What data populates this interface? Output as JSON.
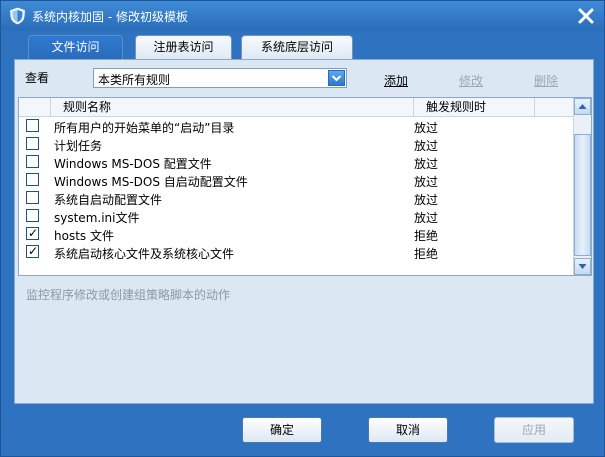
{
  "window": {
    "title": "系统内核加固  -  修改初级模板"
  },
  "tabs": [
    {
      "label": "文件访问",
      "active": true
    },
    {
      "label": "注册表访问",
      "active": false
    },
    {
      "label": "系统底层访问",
      "active": false
    }
  ],
  "filter": {
    "label": "查看",
    "selected": "本类所有规则"
  },
  "actions": {
    "add": "添加",
    "edit": "修改",
    "delete": "删除"
  },
  "list": {
    "columns": [
      "规则名称",
      "触发规则时"
    ],
    "rows": [
      {
        "name": "所有用户的开始菜单的“启动”目录",
        "trigger": "放过",
        "checked": false
      },
      {
        "name": "计划任务",
        "trigger": "放过",
        "checked": false
      },
      {
        "name": "Windows MS-DOS 配置文件",
        "trigger": "放过",
        "checked": false
      },
      {
        "name": "Windows MS-DOS 自启动配置文件",
        "trigger": "放过",
        "checked": false
      },
      {
        "name": "系统自启动配置文件",
        "trigger": "放过",
        "checked": false
      },
      {
        "name": "system.ini文件",
        "trigger": "放过",
        "checked": false
      },
      {
        "name": "hosts 文件",
        "trigger": "拒绝",
        "checked": true
      },
      {
        "name": "系统启动核心文件及系统核心文件",
        "trigger": "拒绝",
        "checked": true
      }
    ]
  },
  "description": "监控程序修改或创建组策略脚本的动作",
  "buttons": {
    "ok": "确定",
    "cancel": "取消",
    "apply": "应用"
  },
  "colors": {
    "title_bar": "#2f72bf",
    "active_tab": "#2f7ad3",
    "panel_bg": "#dbe8f3",
    "disabled_text": "#9aa8b8"
  }
}
